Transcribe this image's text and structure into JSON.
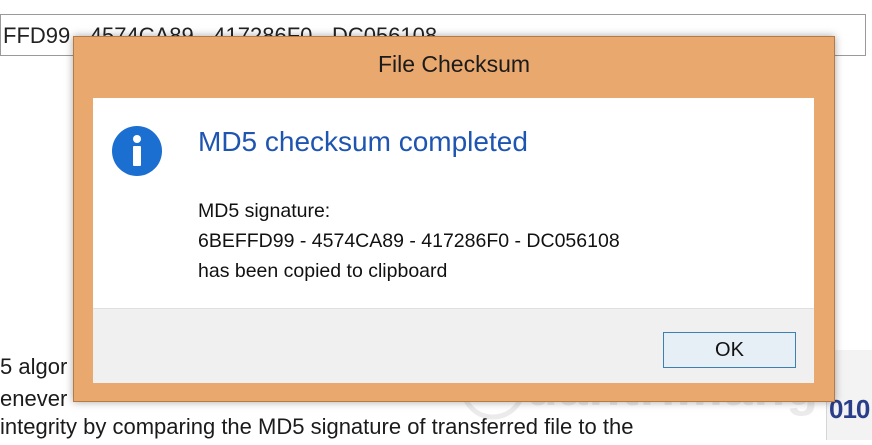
{
  "background": {
    "field_text": "FFD99 - 4574CA89 - 417286F0 - DC056108",
    "lines": [
      "5 algor",
      "enever",
      "integrity by comparing the MD5 signature of transferred file to the"
    ],
    "thumb_text": "010",
    "watermark_text": "uantrimang"
  },
  "dialog": {
    "title": "File Checksum",
    "icon": "info-icon",
    "main_instruction": "MD5 checksum completed",
    "content": {
      "line1": "MD5 signature:",
      "line2": "6BEFFD99 - 4574CA89 - 417286F0 - DC056108",
      "line3": "has been copied to clipboard"
    },
    "ok_label": "OK"
  },
  "colors": {
    "frame": "#e9a86e",
    "instruction": "#1e55b0",
    "icon": "#1b6fd0",
    "button_border": "#3c7fb1"
  }
}
